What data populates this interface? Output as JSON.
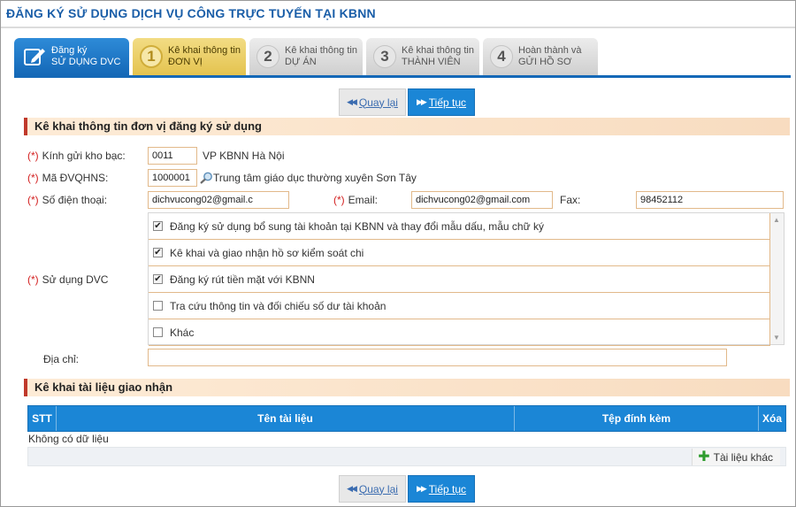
{
  "page_title": "ĐĂNG KÝ SỬ DỤNG DỊCH VỤ CÔNG TRỰC TUYẾN TẠI KBNN",
  "steps": [
    {
      "line1": "Đăng ký",
      "line2": "SỬ DỤNG DVC"
    },
    {
      "num": "1",
      "line1": "Kê khai thông tin",
      "line2": "ĐƠN VỊ"
    },
    {
      "num": "2",
      "line1": "Kê khai thông tin",
      "line2": "DỰ ÁN"
    },
    {
      "num": "3",
      "line1": "Kê khai thông tin",
      "line2": "THÀNH VIÊN"
    },
    {
      "num": "4",
      "line1": "Hoàn thành và",
      "line2": "GỬI HỒ SƠ"
    }
  ],
  "nav": {
    "back_label": "Quay lại",
    "next_label": "Tiếp tục"
  },
  "section1": {
    "title": "Kê khai thông tin đơn vị đăng ký sử dụng"
  },
  "form": {
    "required_mark": "(*)",
    "kbnn": {
      "label": "Kính gửi kho bạc:",
      "value": "0011",
      "name": "VP KBNN Hà Nội"
    },
    "dvqhns": {
      "label": "Mã ĐVQHNS:",
      "value": "1000001",
      "name": "Trung tâm giáo dục thường xuyên Sơn Tây"
    },
    "phone": {
      "label": "Số điện thoại:",
      "value": "dichvucong02@gmail.c"
    },
    "email": {
      "label": "Email:",
      "value": "dichvucong02@gmail.com"
    },
    "fax": {
      "label": "Fax:",
      "value": "98452112"
    },
    "dvc": {
      "label": "Sử dụng DVC",
      "items": [
        {
          "text": "Đăng ký sử dụng bổ sung tài khoản tại KBNN và thay đổi mẫu dấu, mẫu chữ ký",
          "checked": true
        },
        {
          "text": "Kê khai và giao nhận hồ sơ kiểm soát chi",
          "checked": true
        },
        {
          "text": "Đăng ký rút tiền mặt với KBNN",
          "checked": true
        },
        {
          "text": "Tra cứu thông tin và đối chiếu số dư tài khoản",
          "checked": false
        },
        {
          "text": "Khác",
          "checked": false
        }
      ]
    },
    "address": {
      "label": "Địa chỉ:",
      "value": ""
    }
  },
  "section2": {
    "title": "Kê khai tài liệu giao nhận"
  },
  "table": {
    "columns": [
      "STT",
      "Tên tài liệu",
      "Tệp đính kèm",
      "Xóa"
    ],
    "empty_text": "Không có dữ liệu",
    "add_label": "Tài liệu khác"
  },
  "colors": {
    "accent": "#1b86d6",
    "title": "#1a5ea8",
    "required": "#d32020",
    "section_bg": "#fdebd6",
    "active_step": "#e4c34f"
  },
  "icons": [
    "edit-icon",
    "search-icon",
    "back-arrow-icon",
    "next-arrow-icon",
    "plus-icon",
    "checkbox-icon"
  ]
}
